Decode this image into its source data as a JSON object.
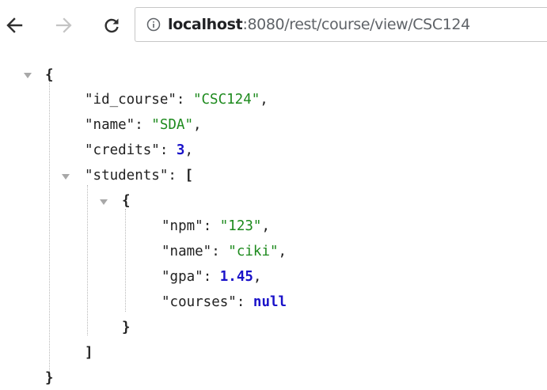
{
  "toolbar": {
    "back_icon": "back-arrow-icon",
    "forward_icon": "forward-arrow-icon",
    "reload_icon": "reload-icon",
    "info_icon": "info-icon",
    "url_host": "localhost",
    "url_path": ":8080/rest/course/view/CSC124"
  },
  "json": {
    "id_course_key": "\"id_course\"",
    "id_course_value": "\"CSC124\"",
    "name_key": "\"name\"",
    "name_value": "\"SDA\"",
    "credits_key": "\"credits\"",
    "credits_value": "3",
    "students_key": "\"students\"",
    "student": {
      "npm_key": "\"npm\"",
      "npm_value": "\"123\"",
      "name_key": "\"name\"",
      "name_value": "\"ciki\"",
      "gpa_key": "\"gpa\"",
      "gpa_value": "1.45",
      "courses_key": "\"courses\"",
      "courses_value": "null"
    }
  },
  "colors": {
    "string": "#1d8a1d",
    "number": "#1a12c9",
    "text": "#222222"
  }
}
